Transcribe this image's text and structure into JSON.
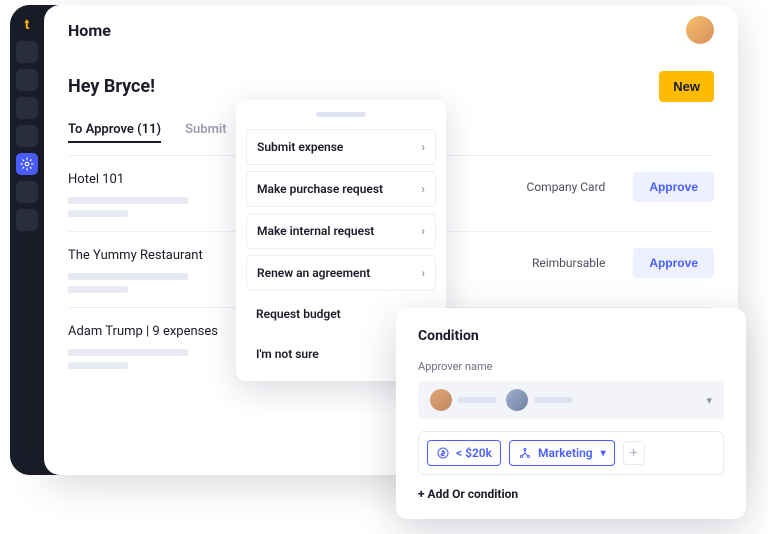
{
  "header": {
    "title": "Home"
  },
  "greeting": "Hey Bryce!",
  "new_button": "New",
  "tabs": {
    "to_approve": "To Approve (11)",
    "submit": "Submit"
  },
  "expenses": [
    {
      "title": "Hotel 101",
      "type": "Company Card",
      "action": "Approve"
    },
    {
      "title": "The Yummy Restaurant",
      "type": "Reimbursable",
      "action": "Approve"
    },
    {
      "title": "Adam Trump | 9 expenses",
      "type": "",
      "action": ""
    }
  ],
  "action_menu": {
    "items": [
      {
        "label": "Submit expense",
        "has_sub": true
      },
      {
        "label": "Make purchase request",
        "has_sub": true
      },
      {
        "label": "Make internal request",
        "has_sub": true
      },
      {
        "label": "Renew an agreement",
        "has_sub": true
      },
      {
        "label": "Request budget",
        "has_sub": false
      },
      {
        "label": "I'm not sure",
        "has_sub": false
      }
    ]
  },
  "condition": {
    "title": "Condition",
    "approver_label": "Approver name",
    "chips": {
      "amount": "< $20k",
      "department": "Marketing"
    },
    "add_or": "+ Add Or condition"
  },
  "colors": {
    "accent": "#4a5fff",
    "warning": "#ffbb00"
  }
}
